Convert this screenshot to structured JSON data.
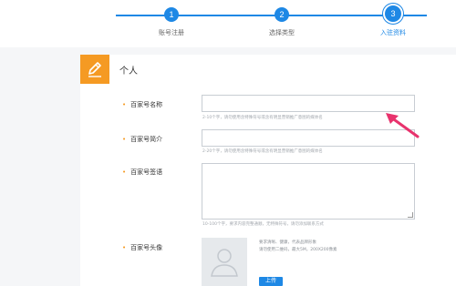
{
  "steps": [
    {
      "number": "1",
      "label": "账号注册"
    },
    {
      "number": "2",
      "label": "选择类型"
    },
    {
      "number": "3",
      "label": "入驻资料"
    }
  ],
  "section": {
    "title": "个人",
    "icon": "pencil-icon"
  },
  "fields": {
    "name": {
      "label": "百家号名称",
      "hint": "2-10个字，请勿使用含特殊符号或含有明显营销推广意图的媒体名"
    },
    "intro": {
      "label": "百家号简介",
      "hint": "2-20个字，请勿使用含特殊符号或含有明显营销推广意图的媒体名"
    },
    "signature": {
      "label": "百家号签语",
      "hint": "10-100个字，要求内容完整通顺，无特殊符号，请勿添加联系方式"
    },
    "avatar": {
      "label": "百家号头像",
      "note_line1": "要求清晰、健康，代表品牌形象",
      "note_line2": "请勿使用二维码，最大5M，200X200像素",
      "upload_label": "上传"
    }
  },
  "colors": {
    "accent": "#1e88e5",
    "section_icon_bg": "#f59a23",
    "annotation_arrow": "#e8336d"
  }
}
